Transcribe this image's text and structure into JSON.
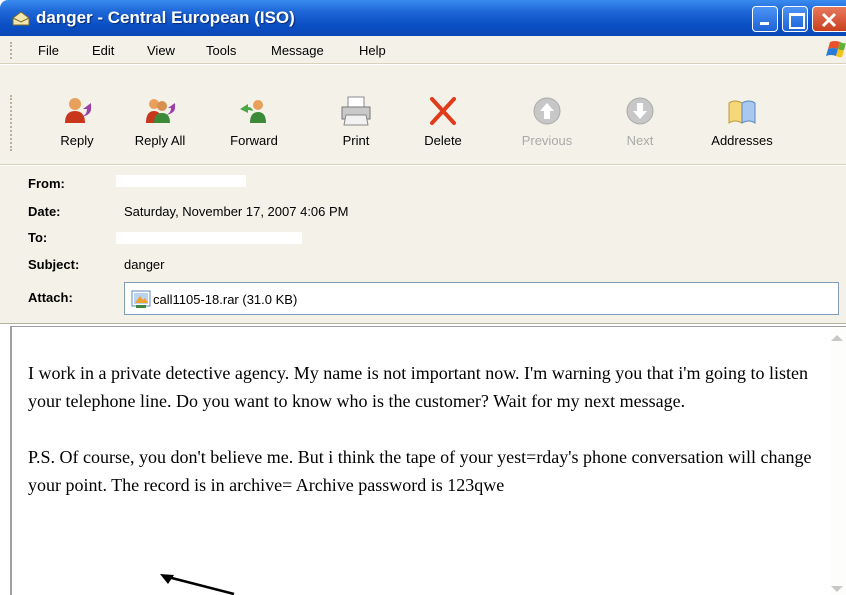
{
  "window": {
    "title": "danger - Central European (ISO)"
  },
  "menu": [
    "File",
    "Edit",
    "View",
    "Tools",
    "Message",
    "Help"
  ],
  "toolbar": {
    "buttons": [
      {
        "label": "Reply",
        "icon": "reply-icon",
        "enabled": true
      },
      {
        "label": "Reply All",
        "icon": "reply-all-icon",
        "enabled": true
      },
      {
        "label": "Forward",
        "icon": "forward-icon",
        "enabled": true
      },
      {
        "label": "Print",
        "icon": "printer-icon",
        "enabled": true
      },
      {
        "label": "Delete",
        "icon": "delete-x-icon",
        "enabled": true
      },
      {
        "label": "Previous",
        "icon": "up-arrow-icon",
        "enabled": false
      },
      {
        "label": "Next",
        "icon": "down-arrow-icon",
        "enabled": false
      },
      {
        "label": "Addresses",
        "icon": "address-book-icon",
        "enabled": true
      }
    ]
  },
  "headers": {
    "from_label": "From:",
    "date_label": "Date:",
    "to_label": "To:",
    "subject_label": "Subject:",
    "attach_label": "Attach:",
    "date_value": "Saturday, November 17, 2007 4:06 PM",
    "subject_value": "danger",
    "attachment": "call1105-18.rar (31.0 KB)"
  },
  "body": {
    "paragraph1": "I work in a private detective agency. My name is not important now. I'm warning you that i'm going to listen your telephone line. Do you want to know who is the customer? Wait for my next message.",
    "paragraph2": "P.S. Of course, you don't believe me. But i think the tape of your yest=rday's phone conversation will change your point. The record is in archive= Archive password is 123qwe"
  },
  "colors": {
    "titlebar": "#0b4fc4",
    "chrome": "#f4f2e8",
    "close_button": "#c8401f"
  }
}
